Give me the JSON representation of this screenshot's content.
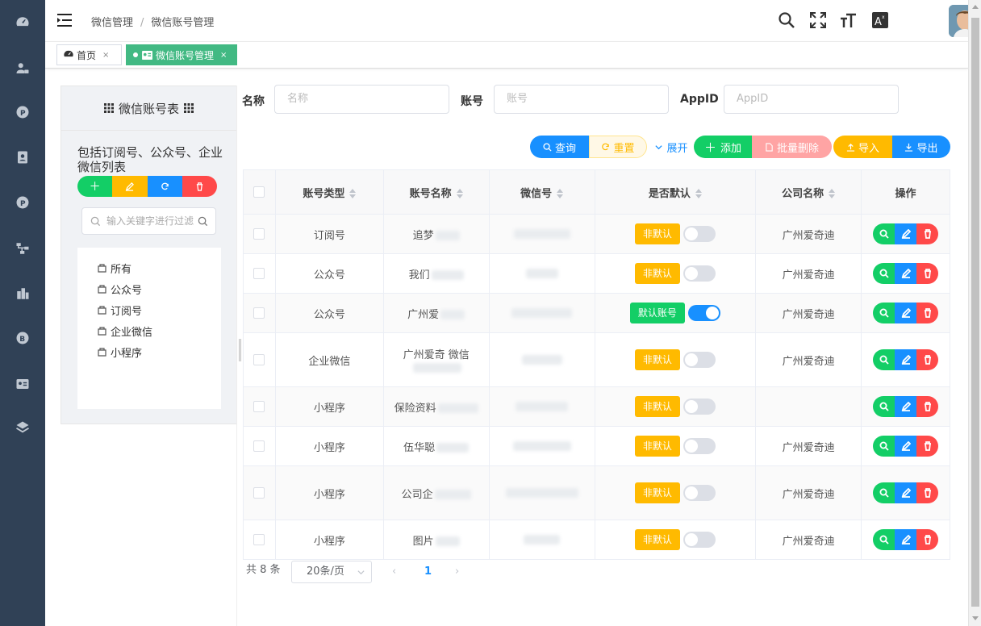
{
  "header": {
    "breadcrumb": [
      "微信管理",
      "微信账号管理"
    ]
  },
  "tags": [
    {
      "label": "首页",
      "close": "×"
    },
    {
      "label": "微信账号管理",
      "close": "×"
    }
  ],
  "left_panel": {
    "title": "微信账号表",
    "description": "包括订阅号、公众号、企业微信列表",
    "search_placeholder": "输入关键字进行过滤",
    "tree": [
      "所有",
      "公众号",
      "订阅号",
      "企业微信",
      "小程序"
    ]
  },
  "filters": [
    {
      "label": "名称",
      "placeholder": "名称"
    },
    {
      "label": "账号",
      "placeholder": "账号"
    },
    {
      "label": "AppID",
      "placeholder": "AppID"
    }
  ],
  "actions": {
    "query": "查询",
    "reset": "重置",
    "expand": "展开",
    "add": "添加",
    "batch_delete": "批量删除",
    "import": "导入",
    "export": "导出"
  },
  "table": {
    "columns": [
      "账号类型",
      "账号名称",
      "微信号",
      "是否默认",
      "公司名称",
      "操作"
    ],
    "rows": [
      {
        "type": "订阅号",
        "name": "追梦",
        "default": "非默认",
        "is_default": false,
        "company": "广州爱奇迪"
      },
      {
        "type": "公众号",
        "name": "我们",
        "default": "非默认",
        "is_default": false,
        "company": "广州爱奇迪"
      },
      {
        "type": "公众号",
        "name": "广州爱",
        "default": "默认账号",
        "is_default": true,
        "company": "广州爱奇迪"
      },
      {
        "type": "企业微信",
        "name": "广州爱奇 微信",
        "default": "非默认",
        "is_default": false,
        "company": "广州爱奇迪"
      },
      {
        "type": "小程序",
        "name": "保险资料",
        "default": "非默认",
        "is_default": false,
        "company": ""
      },
      {
        "type": "小程序",
        "name": "伍华聪",
        "default": "非默认",
        "is_default": false,
        "company": "广州爱奇迪"
      },
      {
        "type": "小程序",
        "name": "公司企",
        "default": "非默认",
        "is_default": false,
        "company": "广州爱奇迪"
      },
      {
        "type": "小程序",
        "name": "图片",
        "default": "非默认",
        "is_default": false,
        "company": "广州爱奇迪"
      }
    ]
  },
  "pagination": {
    "total": "共 8 条",
    "page_size": "20条/页",
    "current": "1"
  },
  "colors": {
    "sidebar": "#304156",
    "green": "#13ce66",
    "yellow": "#ffba00",
    "blue": "#1890ff",
    "red": "#ff4949",
    "tag_active": "#42b983"
  }
}
